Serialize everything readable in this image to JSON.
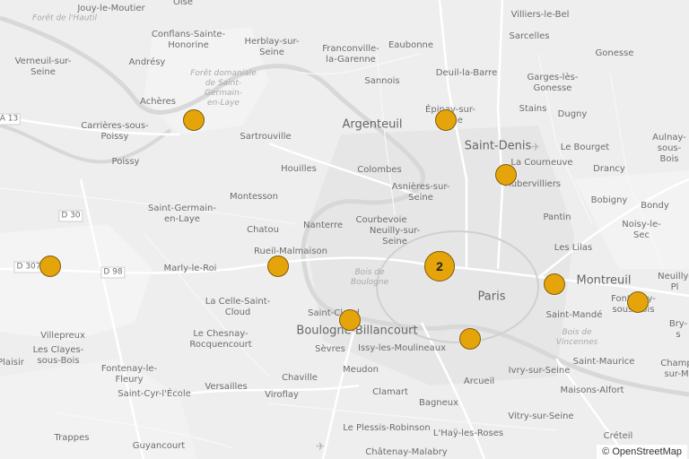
{
  "map": {
    "labels": {
      "jouy": "Jouy-le-Moutier",
      "foret_hautil": "Forêt de l'Hautil",
      "conflans": "Conflans-Sainte-\nHonorine",
      "herblay": "Herblay-sur-\nSeine",
      "franconville": "Franconville-\nla-Garenne",
      "eaubonne": "Eaubonne",
      "sarcelles": "Sarcelles",
      "villiers_le_bel": "Villiers-le-Bel",
      "verneuil": "Verneuil-sur-\nSeine",
      "andresy": "Andrésy",
      "foret_st_germain": "Forêt domaniale\nde Saint-\nGermain-\nen-Laye",
      "sannois": "Sannois",
      "deuil": "Deuil-la-Barre",
      "gonesse": "Gonesse",
      "garges": "Garges-lès-\nGonesse",
      "acheres": "Achères",
      "a13": "A 13",
      "argenteuil": "Argenteuil",
      "epinay": "Épinay-sur-\nSeine",
      "stains": "Stains",
      "dugny": "Dugny",
      "carrieres": "Carrières-sous-\nPoissy",
      "sartrouville": "Sartrouville",
      "saint_denis": "Saint-Denis",
      "le_bourget": "Le Bourget",
      "aulnay": "Aulnay-sous-\nBois",
      "poissy": "Poissy",
      "houilles": "Houilles",
      "colombes": "Colombes",
      "la_courneuve": "La Courneuve",
      "drancy": "Drancy",
      "aubervilliers": "Aubervilliers",
      "montesson": "Montesson",
      "asnieres": "Asnières-sur-\nSeine",
      "bobigny": "Bobigny",
      "bondy": "Bondy",
      "d30": "D 30",
      "st_germain": "Saint-Germain-\nen-Laye",
      "courbevoie": "Courbevoie",
      "pantin": "Pantin",
      "nanterre": "Nanterre",
      "neuilly_seine": "Neuilly-sur-\nSeine",
      "chatou": "Chatou",
      "noisy": "Noisy-le-Sec",
      "les_lilas": "Les Lilas",
      "rueil": "Rueil-Malmaison",
      "d307": "D 307",
      "d98": "D 98",
      "marly": "Marly-le-Roi",
      "bois_boulogne": "Bois de\nBoulogne",
      "montreuil": "Montreuil",
      "neuilly_marne": "Neuilly-Pl",
      "fontenay_bois": "Fontenay-\nsous-Bois",
      "paris": "Paris",
      "la_celle": "La Celle-Saint-\nCloud",
      "saint_cloud": "Saint-Cloud",
      "saint_mande": "Saint-Mandé",
      "boulogne": "Boulogne-Billancourt",
      "villepreux": "Villepreux",
      "le_chesnay": "Le Chesnay-\nRocquencourt",
      "bry": "Bry-s",
      "les_clayes": "Les Clayes-\nsous-Bois",
      "sevres": "Sèvres",
      "issy": "Issy-les-Moulineaux",
      "bois_vincennes": "Bois de\nVincennes",
      "plaisir": "Plaisir",
      "ivry": "Ivry-sur-Seine",
      "saint_maurice": "Saint-Maurice",
      "champigny": "Champ\nsur-M",
      "fontenay_fleury": "Fontenay-le-\nFleury",
      "meudon": "Meudon",
      "versailles": "Versailles",
      "chaville": "Chaville",
      "arcueil": "Arcueil",
      "clamart": "Clamart",
      "maisons_alfort": "Maisons-Alfort",
      "saint_cyr": "Saint-Cyr-l'École",
      "viroflay": "Viroflay",
      "bagneux": "Bagneux",
      "vitry": "Vitry-sur-Seine",
      "le_plessis": "Le Plessis-Robinson",
      "trappes": "Trappes",
      "hay": "L'Haÿ-les-Roses",
      "creteil": "Créteil",
      "guyancourt": "Guyancourt",
      "chatenay": "Châtenay-Malabry",
      "oise": "Oise"
    },
    "cluster_count": "2",
    "attribution": "© OpenStreetMap",
    "colors": {
      "marker_fill": "#e5a50a",
      "marker_stroke": "#7a5a0c",
      "background": "#eeeeee",
      "road": "#ffffff",
      "river": "#d4d4d4"
    }
  }
}
